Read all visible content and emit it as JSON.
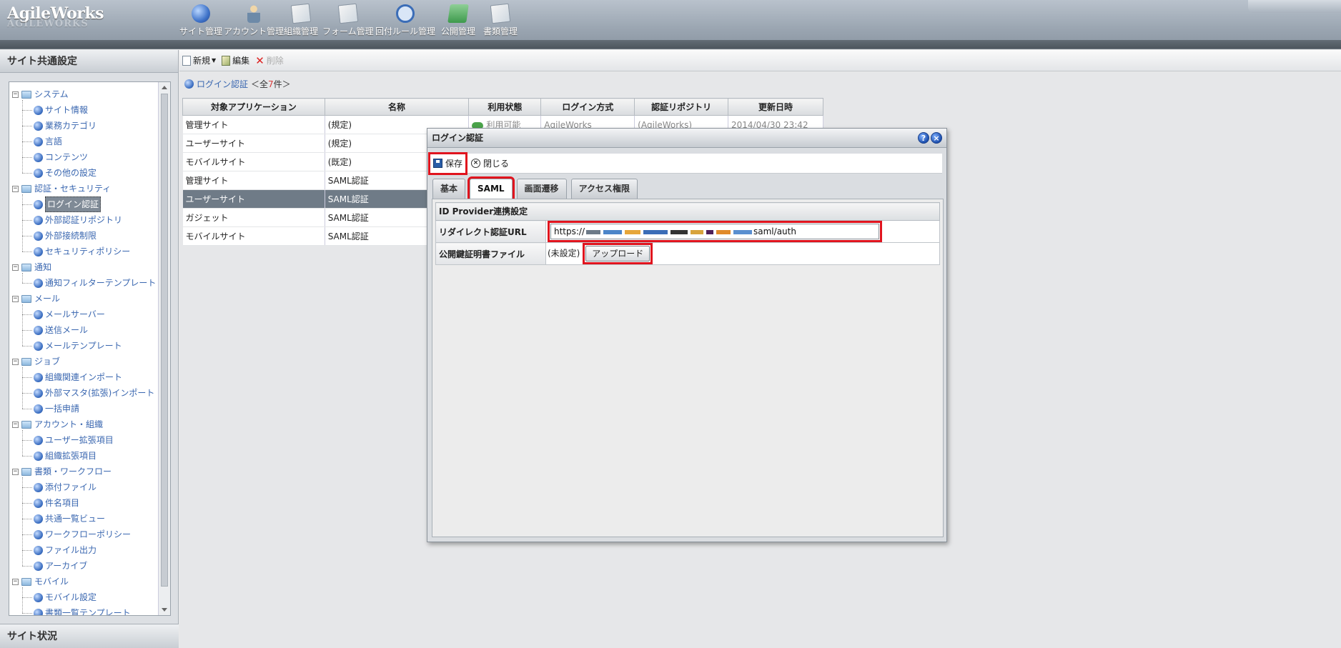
{
  "app": {
    "logo": "AgileWorks",
    "logo_sub": "AGILEWORKS"
  },
  "nav": [
    {
      "label": "サイト管理",
      "icon": "globe-icon"
    },
    {
      "label": "アカウント管理",
      "icon": "person-icon"
    },
    {
      "label": "組織管理",
      "icon": "org-icon"
    },
    {
      "label": "フォーム管理",
      "icon": "form-icon"
    },
    {
      "label": "回付ルール管理",
      "icon": "route-icon"
    },
    {
      "label": "公開管理",
      "icon": "folder-icon"
    },
    {
      "label": "書類管理",
      "icon": "document-icon"
    }
  ],
  "left": {
    "title": "サイト共通設定",
    "footer_title": "サイト状況",
    "tree": [
      {
        "label": "システム",
        "type": "folder",
        "level": 0
      },
      {
        "label": "サイト情報",
        "type": "leaf",
        "level": 1
      },
      {
        "label": "業務カテゴリ",
        "type": "leaf",
        "level": 1
      },
      {
        "label": "言語",
        "type": "leaf",
        "level": 1
      },
      {
        "label": "コンテンツ",
        "type": "leaf",
        "level": 1
      },
      {
        "label": "その他の設定",
        "type": "leaf",
        "level": 1
      },
      {
        "label": "認証・セキュリティ",
        "type": "folder",
        "level": 0
      },
      {
        "label": "ログイン認証",
        "type": "leaf",
        "level": 1,
        "selected": true
      },
      {
        "label": "外部認証リポジトリ",
        "type": "leaf",
        "level": 1
      },
      {
        "label": "外部接続制限",
        "type": "leaf",
        "level": 1
      },
      {
        "label": "セキュリティポリシー",
        "type": "leaf",
        "level": 1
      },
      {
        "label": "通知",
        "type": "folder",
        "level": 0
      },
      {
        "label": "通知フィルターテンプレート",
        "type": "leaf",
        "level": 1
      },
      {
        "label": "メール",
        "type": "folder",
        "level": 0
      },
      {
        "label": "メールサーバー",
        "type": "leaf",
        "level": 1
      },
      {
        "label": "送信メール",
        "type": "leaf",
        "level": 1
      },
      {
        "label": "メールテンプレート",
        "type": "leaf",
        "level": 1
      },
      {
        "label": "ジョブ",
        "type": "folder",
        "level": 0
      },
      {
        "label": "組織関連インポート",
        "type": "leaf",
        "level": 1
      },
      {
        "label": "外部マスタ(拡張)インポート",
        "type": "leaf",
        "level": 1
      },
      {
        "label": "一括申請",
        "type": "leaf",
        "level": 1
      },
      {
        "label": "アカウント・組織",
        "type": "folder",
        "level": 0
      },
      {
        "label": "ユーザー拡張項目",
        "type": "leaf",
        "level": 1
      },
      {
        "label": "組織拡張項目",
        "type": "leaf",
        "level": 1
      },
      {
        "label": "書類・ワークフロー",
        "type": "folder",
        "level": 0
      },
      {
        "label": "添付ファイル",
        "type": "leaf",
        "level": 1
      },
      {
        "label": "件名項目",
        "type": "leaf",
        "level": 1
      },
      {
        "label": "共通一覧ビュー",
        "type": "leaf",
        "level": 1
      },
      {
        "label": "ワークフローポリシー",
        "type": "leaf",
        "level": 1
      },
      {
        "label": "ファイル出力",
        "type": "leaf",
        "level": 1
      },
      {
        "label": "アーカイブ",
        "type": "leaf",
        "level": 1
      },
      {
        "label": "モバイル",
        "type": "folder",
        "level": 0
      },
      {
        "label": "モバイル設定",
        "type": "leaf",
        "level": 1
      },
      {
        "label": "書類一覧テンプレート",
        "type": "leaf",
        "level": 1
      }
    ]
  },
  "toolbar": {
    "new": "新規",
    "edit": "編集",
    "delete": "削除"
  },
  "breadcrumb": {
    "link": "ログイン認証",
    "prefix": "＜全",
    "count": "7",
    "suffix": "件＞"
  },
  "grid": {
    "headers": [
      "対象アプリケーション",
      "名称",
      "利用状態",
      "ログイン方式",
      "認証リポジトリ",
      "更新日時"
    ],
    "rows": [
      [
        "管理サイト",
        "(規定)",
        "利用可能",
        "AgileWorks",
        "(AgileWorks)",
        "2014/04/30 23:42"
      ],
      [
        "ユーザーサイト",
        "(規定)",
        "",
        "",
        "",
        ""
      ],
      [
        "モバイルサイト",
        "(既定)",
        "",
        "",
        "",
        ""
      ],
      [
        "管理サイト",
        "SAML認証",
        "",
        "",
        "",
        ""
      ],
      [
        "ユーザーサイト",
        "SAML認証",
        "",
        "",
        "",
        ""
      ],
      [
        "ガジェット",
        "SAML認証",
        "",
        "",
        "",
        ""
      ],
      [
        "モバイルサイト",
        "SAML認証",
        "",
        "",
        "",
        ""
      ]
    ],
    "selected_row": 4
  },
  "dialog": {
    "title": "ログイン認証",
    "save": "保存",
    "close": "閉じる",
    "tabs": [
      "基本",
      "SAML",
      "画面遷移",
      "アクセス権限"
    ],
    "active_tab": 1,
    "section": "ID Provider連携設定",
    "url_label": "リダイレクト認証URL",
    "url_prefix": "https://",
    "url_suffix": "saml/auth",
    "cert_label": "公開鍵証明書ファイル",
    "cert_value": "(未設定)",
    "upload": "アップロード"
  },
  "colors": {
    "highlight": "#e0141e",
    "link": "#3a67b0",
    "selected_row": "#6f7b87"
  }
}
